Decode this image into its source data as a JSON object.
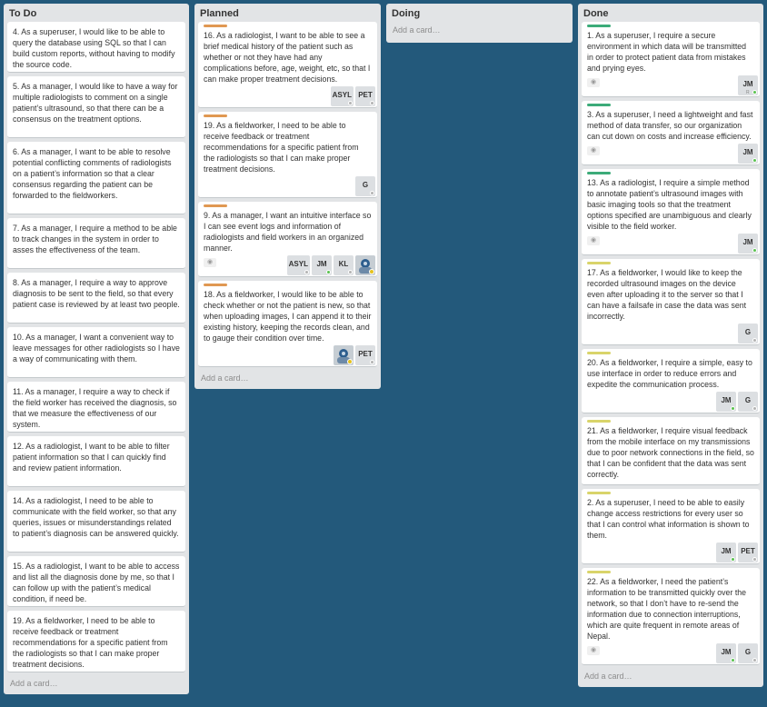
{
  "lists": {
    "todo": {
      "title": "To Do",
      "add_card": "Add a card…",
      "cards": [
        {
          "text": "4. As a superuser, I would like to be able to query the database using SQL so that I can build custom reports, without having to modify the source code."
        },
        {
          "text": "5. As a manager, I would like to have a way for multiple radiologists to comment on a single patient’s ultrasound, so that there can be a consensus on the treatment options."
        },
        {
          "text": "6. As a manager, I want to be able to resolve potential conflicting comments of radiologists on a patient’s information so that a clear consensus regarding the patient can be forwarded to the fieldworkers."
        },
        {
          "text": "7. As a manager, I require a method to be able to track changes in the system in order to asses the effectiveness of the team."
        },
        {
          "text": "8. As a manager, I require a way to approve diagnosis to be sent to the field, so that every patient case is reviewed by at least two people."
        },
        {
          "text": "10. As a manager, I want a convenient way to leave messages for other radiologists so I have a way of communicating with them."
        },
        {
          "text": "11. As a manager, I require a way to check if the field worker has received the diagnosis, so that we measure the effectiveness of our system."
        },
        {
          "text": "12. As a radiologist, I want to be able to filter patient information so that I can quickly find and review patient information."
        },
        {
          "text": "14. As a radiologist, I need to be able to communicate with the field worker, so that any queries, issues or misunderstandings related to patient’s diagnosis can be answered quickly."
        },
        {
          "text": "15. As a radiologist, I want to be able to access and list all the diagnosis done by me, so that I can follow up with the patient’s medical condition, if need be."
        },
        {
          "text": "19. As a fieldworker, I need to be able to receive feedback or treatment recommendations for a specific patient from the radiologists so that I can make proper treatment decisions."
        }
      ]
    },
    "planned": {
      "title": "Planned",
      "add_card": "Add a card…",
      "cards": [
        {
          "text": "16. As a radiologist, I want to be able to see a brief medical history of the patient such as whether or not they have had any complications before, age, weight, etc, so that I can make proper treatment decisions.",
          "members": [
            "ASYL",
            "PET"
          ]
        },
        {
          "text": "19. As a fieldworker, I need to be able to receive feedback or treatment recommendations for a specific patient from the radiologists so that I can make proper treatment decisions.",
          "members": [
            "G"
          ]
        },
        {
          "text": "9. As a manager, I want an intuitive interface so I can see event logs and information of radiologists and field workers in an organized manner.",
          "members": [
            "ASYL",
            "JM",
            "KL"
          ]
        },
        {
          "text": "18. As a fieldworker, I would like to be able to check whether or not the patient is new, so that when uploading images, I can append it to their existing history, keeping the records clean, and to gauge their condition over time.",
          "members": [
            "PET"
          ]
        }
      ]
    },
    "doing": {
      "title": "Doing",
      "add_card": "Add a card…"
    },
    "done": {
      "title": "Done",
      "add_card": "Add a card…",
      "cards": [
        {
          "text": "1. As a superuser, I require a secure environment in which data will be transmitted in order to protect patient data from mistakes and prying eyes.",
          "members": [
            "JM"
          ],
          "member_flag": "R"
        },
        {
          "text": "3. As a superuser, I need a lightweight and fast method of data transfer, so our organization can cut down on costs and increase efficiency.",
          "members": [
            "JM"
          ]
        },
        {
          "text": "13. As a radiologist, I require a simple method to annotate patient’s ultrasound images with basic imaging tools so that the treatment options specified are unambiguous and clearly visible to the field worker.",
          "members": [
            "JM"
          ]
        },
        {
          "text": "17. As a fieldworker, I would like to keep the recorded ultrasound images on the device even after uploading it to the server so that I can have a failsafe in case the data was sent incorrectly.",
          "members": [
            "G"
          ]
        },
        {
          "text": "20. As a fieldworker, I require a simple, easy to use interface in order to reduce errors and expedite the communication process.",
          "members": [
            "JM",
            "G"
          ]
        },
        {
          "text": "21. As a fieldworker, I require visual feedback from the mobile interface on my transmissions due to poor network connections in the field, so that I can be confident that the data was sent correctly."
        },
        {
          "text": "2. As a superuser, I need to be able to easily change access restrictions for every user so that I can control what information is shown to them.",
          "members": [
            "JM",
            "PET"
          ]
        },
        {
          "text": "22. As a fieldworker, I need the patient’s information to be transmitted quickly over the network, so that I don’t have to re-send the information due to connection interruptions, which are quite frequent in remote areas of Nepal.",
          "members": [
            "JM",
            "G"
          ]
        }
      ]
    }
  },
  "colors": {
    "board_bg": "#23597b",
    "list_bg": "#e2e4e6",
    "label_orange": "#e09852",
    "label_green": "#3cab79",
    "label_yellow": "#d9d46a"
  }
}
